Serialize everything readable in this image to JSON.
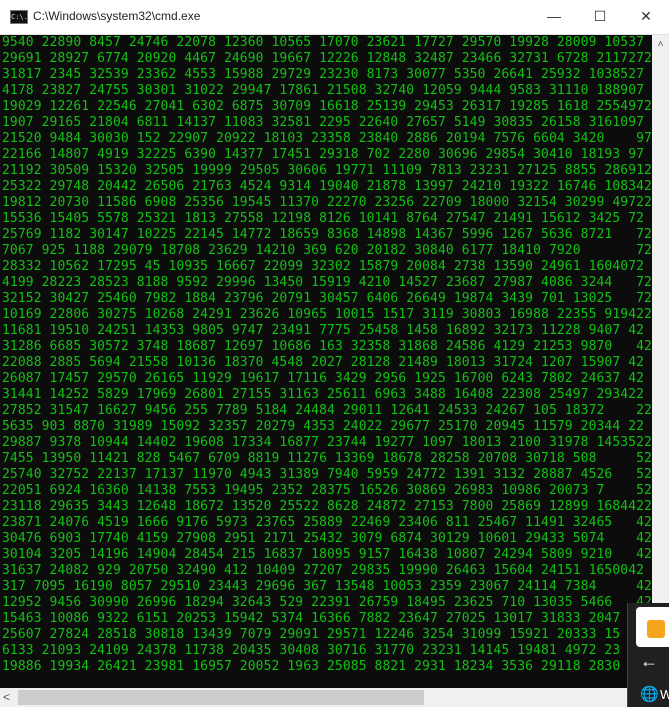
{
  "window": {
    "title": "C:\\Windows\\system32\\cmd.exe",
    "icon_text": "C:\\.",
    "minimize": "—",
    "maximize": "☐",
    "close": "✕"
  },
  "console": {
    "lines": [
      "9540 22890 8457 24746 22078 12360 10565 17070 23621 17727 29570 19928 28009 10537",
      "29691 28927 6774 20920 4467 24690 19667 12226 12848 32487 23466 32731 6728 2117272",
      "31817 2345 32539 23362 4553 15988 29729 23230 8173 30077 5350 26641 25932 1038527",
      "4178 23827 24755 30301 31022 29947 17861 21508 32740 12059 9444 9583 31110 188907",
      "19029 12261 22546 27041 6302 6875 30709 16618 25139 29453 26317 19285 1618 2554972",
      "1907 29165 21804 6811 14137 11083 32581 2295 22640 27657 5149 30835 26158 3161097",
      "21520 9484 30030 152 22907 20922 18103 23358 23840 2886 20194 7576 6604 3420    97",
      "22166 14807 4919 32225 6390 14377 17451 29318 702 2280 30696 29854 30410 18193 97",
      "21192 30509 15320 32505 19999 29505 30606 19771 11109 7813 23231 27125 8855 286912",
      "25322 29748 20442 26506 21763 4524 9314 19040 21878 13997 24210 19322 16746 108342",
      "19812 20730 11586 6908 25356 19545 11370 22270 23256 22709 18000 32154 30299 49722",
      "15536 15405 5578 25321 1813 27558 12198 8126 10141 8764 27547 21491 15612 3425 72",
      "25769 1182 30147 10225 22145 14772 18659 8368 14898 14367 5996 1267 5636 8721   72",
      "7067 925 1188 29079 18708 23629 14210 369 620 20182 30840 6177 18410 7920       72",
      "28332 10562 17295 45 10935 16667 22099 32302 15879 20084 2738 13590 24961 1604072",
      "4199 28223 28523 8188 9592 29996 13450 15919 4210 14527 23687 27987 4086 3244   72",
      "32152 30427 25460 7982 1884 23796 20791 30457 6406 26649 19874 3439 701 13025   72",
      "10169 22806 30275 10268 24291 23626 10965 10015 1517 3119 30803 16988 22355 919422",
      "11681 19510 24251 14353 9805 9747 23491 7775 25458 1458 16892 32173 11228 9407 42",
      "31286 6685 30572 3748 18687 12697 10686 163 32358 31868 24586 4129 21253 9870   42",
      "22088 2885 5694 21558 10136 18370 4548 2027 28128 21489 18013 31724 1207 15907 42",
      "26087 17457 29570 26165 11929 19617 17116 3429 2956 1925 16700 6243 7802 24637 42",
      "31441 14252 5829 17969 26801 27155 31163 25611 6963 3488 16408 22308 25497 293422",
      "27852 31547 16627 9456 255 7789 5184 24484 29011 12641 24533 24267 105 18372    22",
      "5635 903 8870 31989 15092 32357 20279 4353 24022 29677 25170 20945 11579 20344 22",
      "29887 9378 10944 14402 19608 17334 16877 23744 19277 1097 18013 2100 31978 1453522",
      "7455 13950 11421 828 5467 6709 8819 11276 13369 18678 28258 20708 30718 508     52",
      "25740 32752 22137 17137 11970 4943 31389 7940 5959 24772 1391 3132 28887 4526   52",
      "22051 6924 16360 14138 7553 19495 2352 28375 16526 30869 26983 10986 20073 7    52",
      "23118 29635 3443 12648 18672 13520 25522 8628 24872 27153 7800 25869 12899 1684422",
      "23871 24076 4519 1666 9176 5973 23765 25889 22469 23406 811 25467 11491 32465   42",
      "30476 6903 17740 4159 27908 2951 2171 25432 3079 6874 30129 10601 29433 5074    42",
      "30104 3205 14196 14904 28454 215 16837 18095 9157 16438 10807 24294 5809 9210   42",
      "31637 24082 929 20750 32490 412 10409 27207 29835 19990 26463 15604 24151 1650042",
      "317 7095 16190 8057 29510 23443 29696 367 13548 10053 2359 23067 24114 7384     42",
      "12952 9456 30990 26996 18294 32643 529 22391 26759 18495 23625 710 13035 5466   42",
      "15463 10086 9322 6151 20253 15942 5374 16366 7882 23647 27025 13017 31833 2047",
      "25607 27824 28518 30818 13439 7079 29091 29571 12246 3254 31099 15921 20333 15",
      "6133 21093 24109 24378 11738 20435 30408 30716 31770 23231 14145 19481 4972 23",
      "19886 19934 26421 23981 16957 20052 1963 25085 8821 2931 18234 3536 29118 2830"
    ]
  },
  "scrollbar": {
    "up_arrow": "˄",
    "left_arrow": "<"
  },
  "overlay": {
    "back_arrow": "←",
    "globe": "🌐",
    "label": "W"
  }
}
